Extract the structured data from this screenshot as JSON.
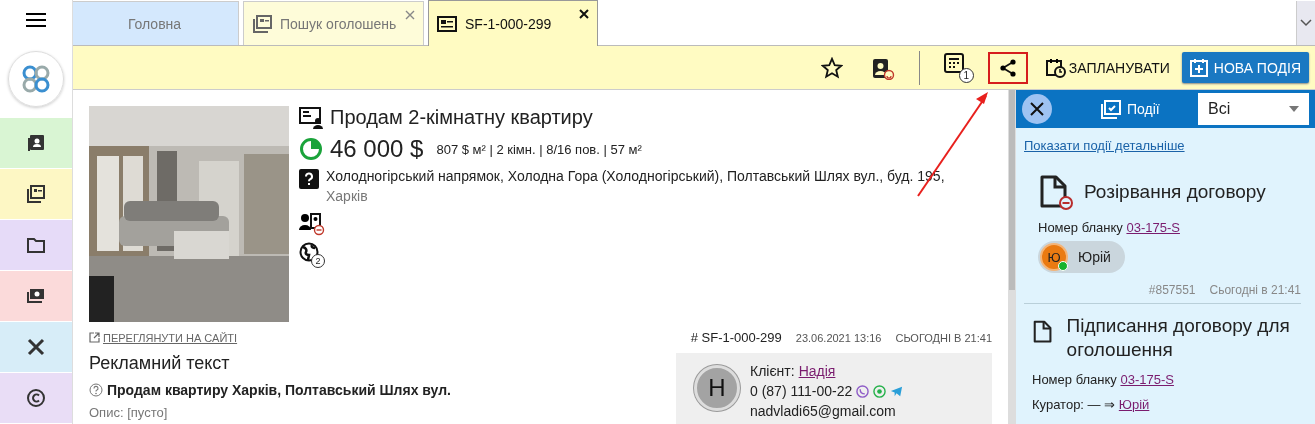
{
  "sidebar": {
    "items": [
      {
        "color": "#d9f5d3"
      },
      {
        "color": "#fdf7c4"
      },
      {
        "color": "#e6dbf8"
      },
      {
        "color": "#fbdada"
      },
      {
        "color": "#d7edf8"
      },
      {
        "color": "#e9ddf6"
      }
    ]
  },
  "tabs": [
    {
      "label": "Головна",
      "selected": false,
      "closable": false,
      "color": "#d4e8fd"
    },
    {
      "label": "Пошук оголошень",
      "selected": false,
      "closable": true,
      "color": "#fefcd9"
    },
    {
      "label": "SF-1-000-299",
      "selected": true,
      "closable": true,
      "color": "#fffbc2"
    }
  ],
  "toolbar": {
    "calc_badge": "1",
    "schedule": "ЗАПЛАНУВАТИ",
    "new_event": "НОВА ПОДІЯ",
    "share_highlighted": true
  },
  "listing": {
    "title": "Продам 2-кімнатну квартиру",
    "price": "46 000 $",
    "details": "807 $ м² | 2 кімн. | 8/16 пов. | 57 м²",
    "address": "Холодногірський напрямок, Холодна Гора (Холодногірський), Полтавський Шлях вул., буд. 195,",
    "city": "Харків",
    "globe_badge": "2",
    "site_link": "ПЕРЕГЛЯНУТИ НА САЙТІ",
    "number": "# SF-1-000-299",
    "created": "23.06.2021 13:16",
    "updated": "СЬОГОДНІ В 21:41",
    "ad_heading": "Рекламний текст",
    "ad_title": "Продам квартиру Харків, Полтавський Шлях вул.",
    "description": "Опис: [пусто]"
  },
  "client": {
    "initial": "Н",
    "label": "Клієнт:",
    "name": "Надія",
    "phone": "0 (87) 111-00-22",
    "email": "nadvladi65@gmail.com"
  },
  "events_panel": {
    "title": "Події",
    "filter": "Всі",
    "details_link": "Показати події детальніше",
    "events": [
      {
        "kind": "terminate",
        "title": "Розірвання договору",
        "form_label": "Номер бланку",
        "form_number": "03-175-S",
        "person_initial": "Ю",
        "person": "Юрій",
        "online": true,
        "id": "#857551",
        "time": "Сьогодні в 21:41"
      },
      {
        "kind": "sign",
        "title": "Підписання договору для оголошення",
        "form_label": "Номер бланку",
        "form_number": "03-175-S",
        "curator_label": "Куратор: — ⇒",
        "curator": "Юрій"
      }
    ]
  }
}
